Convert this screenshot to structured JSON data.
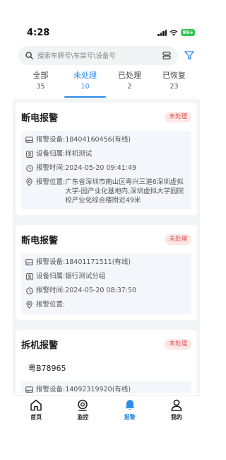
{
  "status_bar": {
    "time": "4:28",
    "battery": "99+"
  },
  "search": {
    "placeholder": "搜索车牌号\\车架号\\设备号"
  },
  "tabs": [
    {
      "label": "全部",
      "count": "35",
      "active": false
    },
    {
      "label": "未处理",
      "count": "10",
      "active": true
    },
    {
      "label": "已处理",
      "count": "2",
      "active": false
    },
    {
      "label": "已恢复",
      "count": "23",
      "active": false
    }
  ],
  "cards": [
    {
      "title": "断电报警",
      "status": "未处理",
      "plate": "",
      "device_label": "报警设备:",
      "device_value": "18404160456(有线)",
      "owner_label": "设备归属:",
      "owner_value": "样机测试",
      "time_label": "报警时间:",
      "time_value": "2024-05-20 09:41:49",
      "location_label": "报警位置:",
      "location_value": "广东省深圳市南山区粤兴三道6深圳虚拟大学-园产业化基地内,深圳虚拟大学园院校产业化综合楼附近49米"
    },
    {
      "title": "断电报警",
      "status": "未处理",
      "plate": "",
      "device_label": "报警设备:",
      "device_value": "18401171511(有线)",
      "owner_label": "设备归属:",
      "owner_value": "银行测试分组",
      "time_label": "报警时间:",
      "time_value": "2024-05-20 08:37:50",
      "location_label": "报警位置:",
      "location_value": ""
    },
    {
      "title": "拆机报警",
      "status": "未处理",
      "plate": "粤B78965",
      "device_label": "报警设备:",
      "device_value": "14092319920(有线)"
    }
  ],
  "bottom_nav": [
    {
      "label": "首页",
      "icon": "home-icon",
      "active": false
    },
    {
      "label": "监控",
      "icon": "monitor-icon",
      "active": false
    },
    {
      "label": "报警",
      "icon": "bell-icon",
      "active": true
    },
    {
      "label": "我的",
      "icon": "user-icon",
      "active": false
    }
  ],
  "colors": {
    "accent": "#2a8be8",
    "badge_bg": "#fde6e6",
    "badge_text": "#e44d4d",
    "battery": "#34c759"
  }
}
